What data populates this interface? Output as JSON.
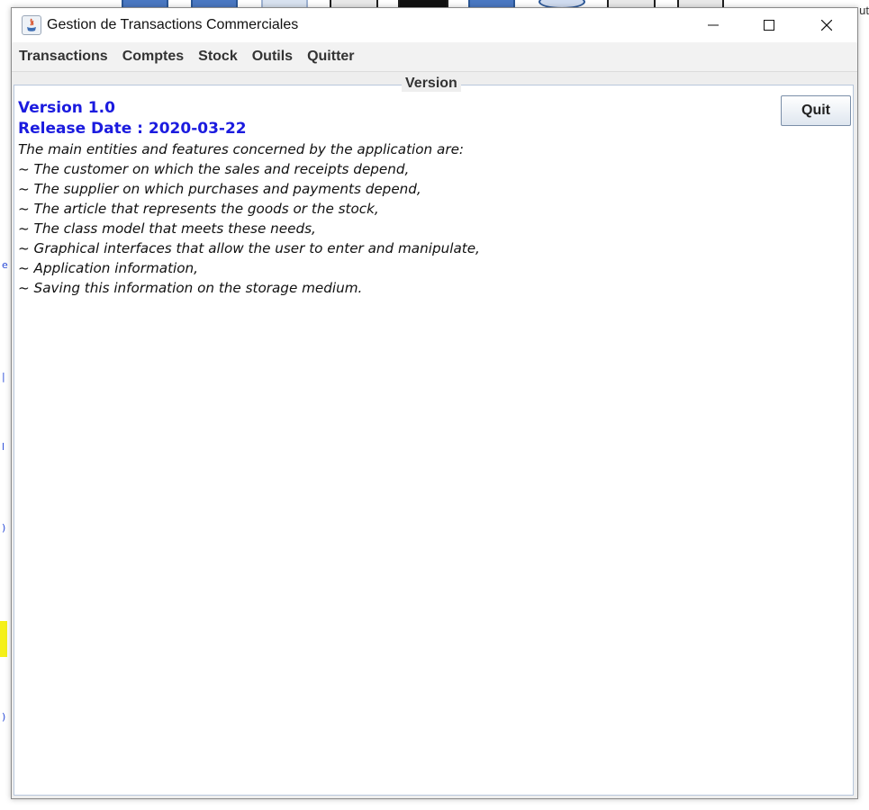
{
  "window": {
    "title": "Gestion de Transactions Commerciales"
  },
  "menu": {
    "items": [
      "Transactions",
      "Comptes",
      "Stock",
      "Outils",
      "Quitter"
    ]
  },
  "panel": {
    "title": "Version",
    "version": "Version 1.0",
    "release_date": "Release Date : 2020-03-22",
    "lines": [
      "The main entities and features concerned by the application are:",
      "~ The customer on which the sales and receipts depend,",
      "~ The supplier on which purchases and payments depend,",
      "~ The article that represents the goods or the stock,",
      "~ The class model that meets these needs,",
      "~ Graphical interfaces that allow the user to enter and manipulate,",
      "~ Application information,",
      "~ Saving this information on the storage medium."
    ],
    "quit_label": "Quit"
  },
  "background": {
    "right_text": "ut"
  },
  "colors": {
    "version_text": "#1b1bdf",
    "panel_border": "#b8c7dc"
  }
}
